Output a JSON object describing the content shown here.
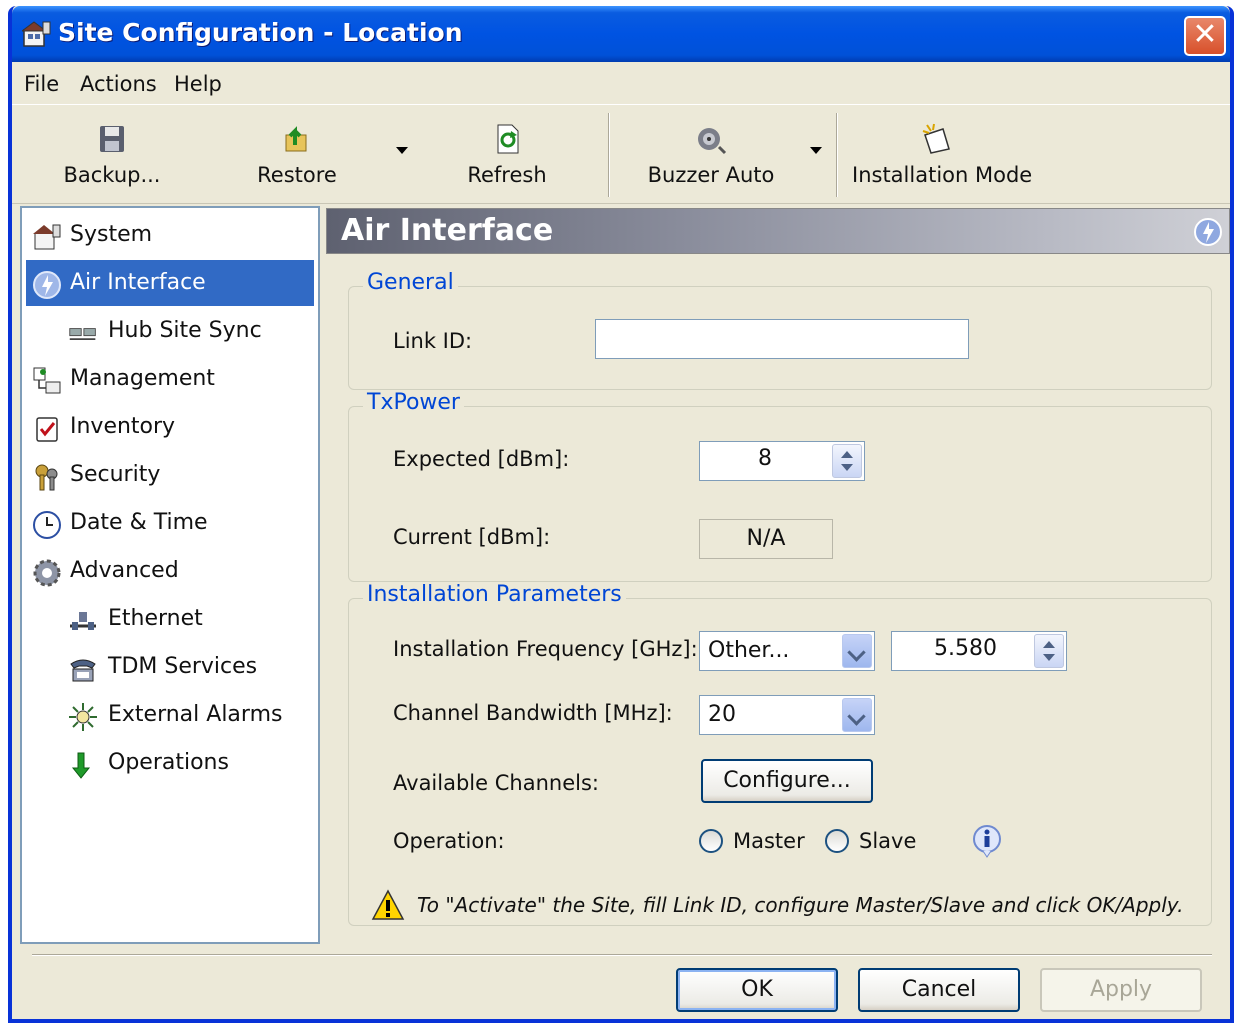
{
  "window": {
    "title": "Site Configuration - Location",
    "close_glyph": "✕"
  },
  "menu": [
    {
      "label": "File"
    },
    {
      "label": "Actions"
    },
    {
      "label": "Help"
    }
  ],
  "toolbar": {
    "backup": "Backup...",
    "restore": "Restore",
    "refresh": "Refresh",
    "buzzer": "Buzzer Auto",
    "installation_mode": "Installation Mode"
  },
  "nav": {
    "items": [
      {
        "label": "System",
        "icon": "system-icon"
      },
      {
        "label": "Air Interface",
        "icon": "air-interface-icon",
        "selected": true
      },
      {
        "label": "Hub Site Sync",
        "icon": "hub-sync-icon"
      },
      {
        "label": "Management",
        "icon": "management-icon"
      },
      {
        "label": "Inventory",
        "icon": "inventory-icon"
      },
      {
        "label": "Security",
        "icon": "security-icon"
      },
      {
        "label": "Date & Time",
        "icon": "clock-icon"
      },
      {
        "label": "Advanced",
        "icon": "gear-icon"
      },
      {
        "label": "Ethernet",
        "icon": "ethernet-icon"
      },
      {
        "label": "TDM Services",
        "icon": "phone-icon"
      },
      {
        "label": "External Alarms",
        "icon": "alarm-icon"
      },
      {
        "label": "Operations",
        "icon": "down-arrow-icon"
      }
    ]
  },
  "panel": {
    "title": "Air Interface",
    "general": {
      "title": "General",
      "link_id_label": "Link ID:",
      "link_id_value": ""
    },
    "txpower": {
      "title": "TxPower",
      "expected_label": "Expected [dBm]:",
      "expected_value": "8",
      "current_label": "Current [dBm]:",
      "current_value": "N/A"
    },
    "install": {
      "title": "Installation Parameters",
      "freq_label": "Installation Frequency [GHz]:",
      "freq_select": "Other...",
      "freq_value": "5.580",
      "bw_label": "Channel Bandwidth [MHz]:",
      "bw_value": "20",
      "channels_label": "Available Channels:",
      "configure_button": "Configure...",
      "operation_label": "Operation:",
      "master": "Master",
      "slave": "Slave",
      "warning": "To \"Activate\" the Site, fill Link ID, configure Master/Slave and click OK/Apply."
    }
  },
  "buttons": {
    "ok": "OK",
    "cancel": "Cancel",
    "apply": "Apply"
  },
  "colors": {
    "title_bar": "#0053e2",
    "selection": "#316ac5",
    "group_title": "#0046d5"
  }
}
